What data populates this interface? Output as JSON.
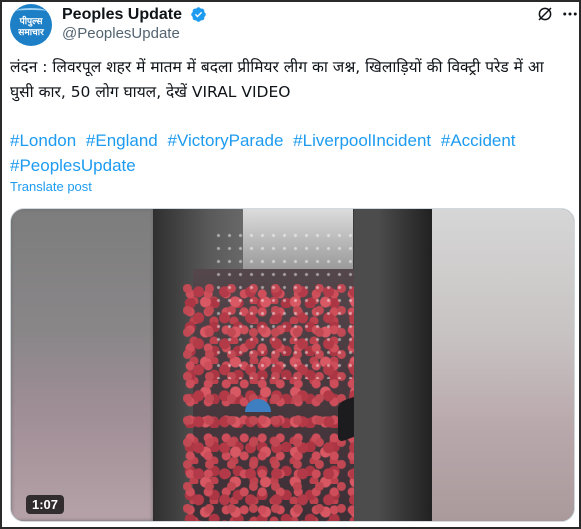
{
  "author": {
    "display_name": "Peoples Update",
    "handle": "@PeoplesUpdate",
    "avatar_text": [
      "पीपुल्स",
      "समाचार"
    ],
    "verified_color": "#1d9bf0"
  },
  "actions": {
    "grok_icon": "grok-icon",
    "more_icon": "more-icon"
  },
  "post": {
    "text": "लंदन : लिवरपूल शहर में मातम में बदला प्रीमियर लीग का जश्न, खिलाड़ियों की विक्ट्री परेड में आ घुसी कार, 50 लोग घायल, देखें VIRAL VIDEO",
    "hashtags": [
      "#London",
      "#England",
      "#VictoryParade",
      "#LiverpoolIncident",
      "#Accident",
      "#PeoplesUpdate"
    ],
    "translate_label": "Translate post"
  },
  "media": {
    "type": "video",
    "duration": "1:07"
  },
  "colors": {
    "link": "#1d9bf0",
    "text": "#0f1419",
    "muted": "#536471"
  }
}
